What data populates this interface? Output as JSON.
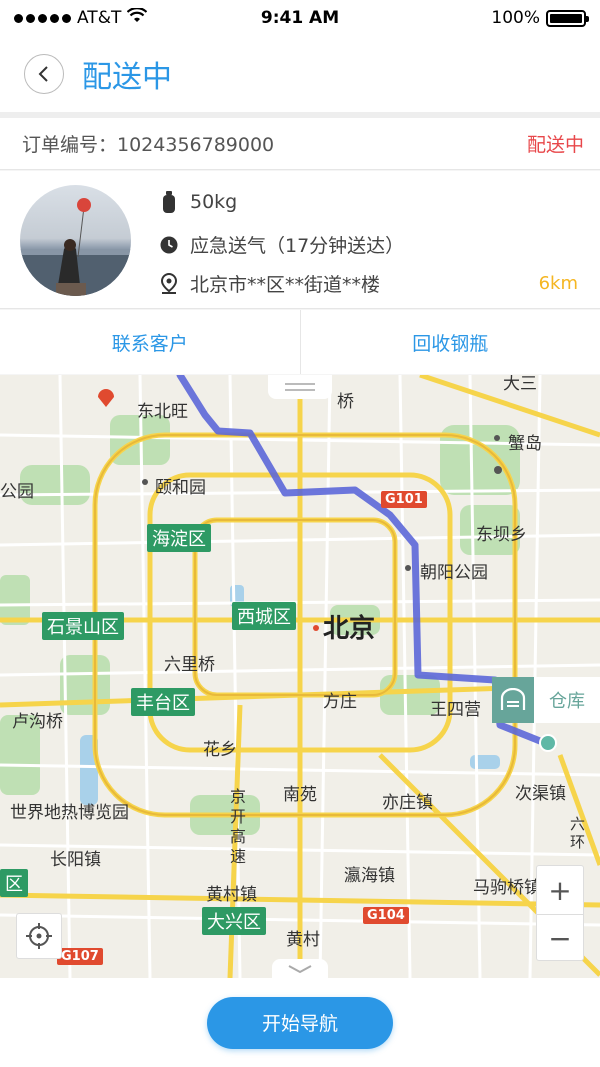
{
  "status_bar": {
    "carrier": "AT&T",
    "time": "9:41 AM",
    "battery": "100%"
  },
  "header": {
    "title": "配送中"
  },
  "order": {
    "label": "订单编号：1024356789000",
    "status": "配送中"
  },
  "info": {
    "weight": "50kg",
    "delivery_type": "应急送气（17分钟送达）",
    "address": "北京市**区**街道**楼",
    "distance": "6km"
  },
  "actions": {
    "contact": "联系客户",
    "recycle": "回收钢瓶"
  },
  "map": {
    "city": "北京",
    "warehouse": "仓库",
    "zoom_in": "+",
    "zoom_out": "−",
    "labels": {
      "dongbeiwang": "东北旺",
      "yiheyuan": "颐和园",
      "gongyuan": "公园",
      "dongbaxiang": "东坝乡",
      "chaoyanggongyuan": "朝阳公园",
      "liulijiao": "六里桥",
      "fangzhuang": "方庄",
      "wangsiying": "王四营",
      "huaxiang": "花乡",
      "nanyuan": "南苑",
      "yizhuangzhen": "亦庄镇",
      "ciqu": "次渠镇",
      "lugouqiao": "卢沟桥",
      "shijie": "世界地热博览园",
      "changyang": "长阳镇",
      "yinghai": "瀛海镇",
      "majuqiao": "马驹桥镇",
      "huangcunzhen": "黄村镇",
      "huangcun": "黄村",
      "xiedao": "蟹岛",
      "daqiao": "桥",
      "jingkai": "京开高速",
      "liuhuan": "六环",
      "dasanyuan": "大三"
    },
    "districts": {
      "haidian": "海淀区",
      "xicheng": "西城区",
      "shijingshan": "石景山区",
      "fengtai": "丰台区",
      "daxing": "大兴区",
      "edge": "区"
    },
    "roads": {
      "g101": "G101",
      "g104": "G104",
      "g107": "G107"
    }
  },
  "bottom": {
    "navigate": "开始导航"
  }
}
